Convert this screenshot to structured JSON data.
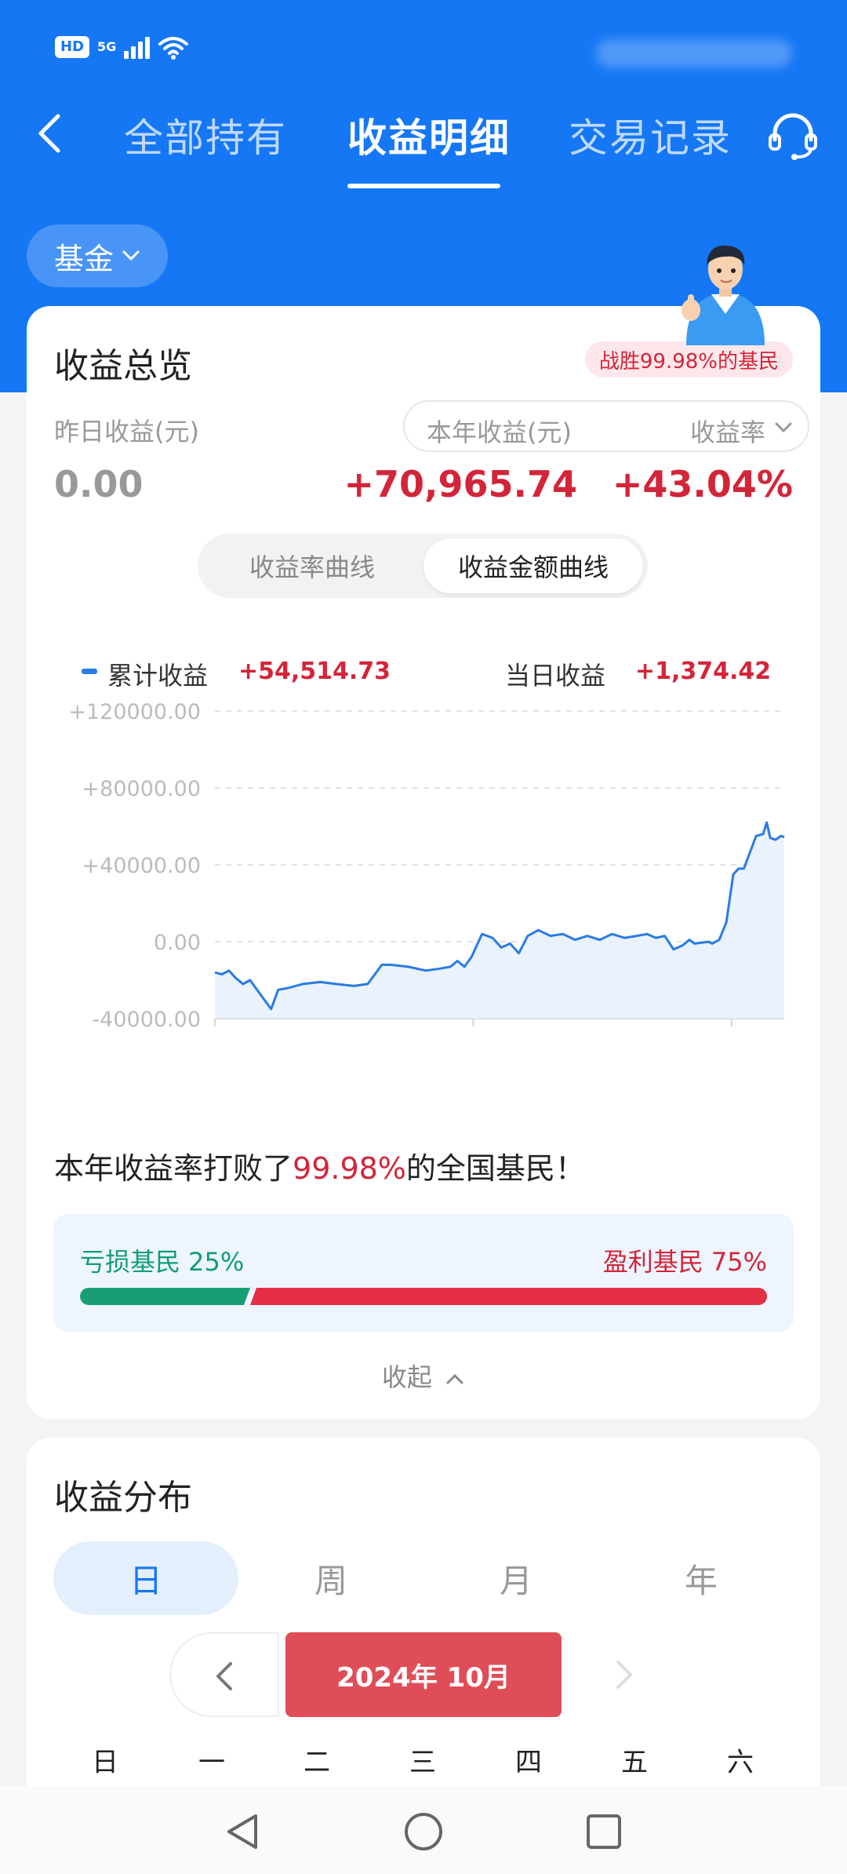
{
  "status_bar": {
    "hd_label": "HD",
    "network_label": "5G"
  },
  "nav": {
    "tabs": [
      {
        "label": "全部持有"
      },
      {
        "label": "收益明细"
      },
      {
        "label": "交易记录"
      }
    ],
    "active_tab": "收益明细"
  },
  "filter": {
    "label": "基金"
  },
  "overview": {
    "title": "收益总览",
    "rank_badge": "战胜99.98%的基民",
    "yesterday_label": "昨日收益(元)",
    "yesterday_value": "0.00",
    "year_label": "本年收益(元)",
    "year_value": "+70,965.74",
    "rate_label": "收益率",
    "rate_value": "+43.04%",
    "curve_tabs": {
      "rate": "收益率曲线",
      "amount": "收益金额曲线"
    },
    "active_curve": "收益金额曲线"
  },
  "chart_data": {
    "type": "area",
    "legend": [
      {
        "name": "累计收益",
        "value": "+54,514.73"
      },
      {
        "name": "当日收益",
        "value": "+1,374.42"
      }
    ],
    "y_ticks": [
      "+120000.00",
      "+80000.00",
      "+40000.00",
      "0.00",
      "-40000.00"
    ],
    "ylim": [
      -40000,
      120000
    ],
    "x_ticks": [
      "2024-01-01",
      "2024-05-27",
      "2024-10-21"
    ],
    "xlim": [
      "2024-01-01",
      "2024-11-20"
    ],
    "grid": true,
    "colors": {
      "line": "#2a7be5",
      "fill": "#e8f1fd",
      "grid": "#e2e2e2"
    },
    "series": [
      {
        "name": "累计收益",
        "x": [
          "2024-01-01",
          "2024-01-05",
          "2024-01-09",
          "2024-01-13",
          "2024-01-17",
          "2024-01-21",
          "2024-01-25",
          "2024-01-29",
          "2024-02-02",
          "2024-02-06",
          "2024-02-12",
          "2024-02-20",
          "2024-03-01",
          "2024-03-10",
          "2024-03-20",
          "2024-03-28",
          "2024-04-05",
          "2024-04-10",
          "2024-04-20",
          "2024-04-30",
          "2024-05-08",
          "2024-05-14",
          "2024-05-18",
          "2024-05-22",
          "2024-05-26",
          "2024-06-01",
          "2024-06-07",
          "2024-06-12",
          "2024-06-17",
          "2024-06-22",
          "2024-06-27",
          "2024-07-03",
          "2024-07-10",
          "2024-07-17",
          "2024-07-24",
          "2024-07-31",
          "2024-08-07",
          "2024-08-14",
          "2024-08-21",
          "2024-08-28",
          "2024-09-03",
          "2024-09-08",
          "2024-09-13",
          "2024-09-18",
          "2024-09-23",
          "2024-09-27",
          "2024-09-30",
          "2024-10-08",
          "2024-10-10",
          "2024-10-14",
          "2024-10-18",
          "2024-10-22",
          "2024-10-25",
          "2024-10-28",
          "2024-11-04",
          "2024-11-08",
          "2024-11-10",
          "2024-11-12",
          "2024-11-15",
          "2024-11-18",
          "2024-11-20"
        ],
        "values": [
          -16000,
          -17000,
          -15000,
          -19000,
          -22000,
          -20000,
          -25000,
          -30000,
          -35000,
          -25000,
          -24000,
          -22000,
          -21000,
          -22000,
          -23000,
          -22000,
          -12000,
          -12000,
          -13000,
          -15000,
          -14000,
          -13000,
          -10000,
          -13000,
          -8000,
          4000,
          2000,
          -3000,
          -1000,
          -6000,
          3000,
          6000,
          3000,
          4000,
          1000,
          3000,
          1000,
          4000,
          2000,
          3000,
          4000,
          2000,
          3000,
          -4000,
          -2000,
          1000,
          -1000,
          0,
          -1000,
          1000,
          10000,
          35000,
          38000,
          38000,
          55000,
          56000,
          62000,
          54000,
          53000,
          55000,
          54500
        ]
      }
    ]
  },
  "beat": {
    "prefix": "本年收益率打败了",
    "highlight": "99.98%",
    "suffix": "的全国基民！"
  },
  "ratio": {
    "loss_label": "亏损基民 25%",
    "profit_label": "盈利基民 75%",
    "loss_fraction": 0.25,
    "profit_fraction": 0.75,
    "loss_color": "#179e77",
    "profit_color": "#e52f44"
  },
  "collapse": {
    "label": "收起"
  },
  "distribution": {
    "title": "收益分布",
    "period_tabs": [
      "日",
      "周",
      "月",
      "年"
    ],
    "active_period": "日",
    "month_label": "2024年 10月",
    "weekdays": [
      "日",
      "一",
      "二",
      "三",
      "四",
      "五",
      "六"
    ]
  },
  "theme": {
    "primary": "#1677f5",
    "profit_red": "#d3253a"
  }
}
